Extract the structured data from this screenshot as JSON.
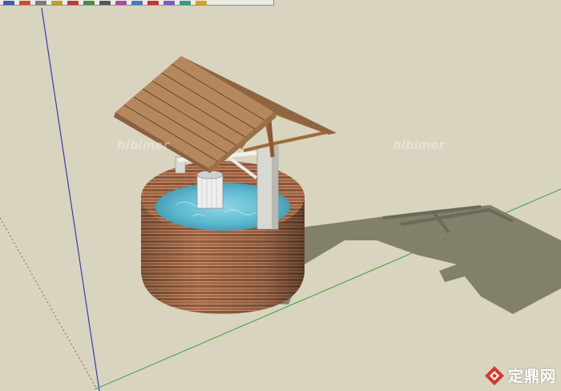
{
  "toolbar": {
    "icons": [
      "select-tool-icon",
      "eraser-tool-icon",
      "paint-tool-icon",
      "pencil-tool-icon",
      "arc-tool-icon",
      "rectangle-tool-icon",
      "push-pull-tool-icon",
      "move-tool-icon",
      "rotate-tool-icon",
      "offset-tool-icon",
      "orbit-tool-icon",
      "pan-tool-icon",
      "zoom-tool-icon"
    ],
    "icon_colors": [
      "#3a5bb8",
      "#d94a2b",
      "#7a7a7a",
      "#c2a01f",
      "#c0392b",
      "#4b8e3c",
      "#555555",
      "#b04aa0",
      "#3a7dc9",
      "#c9302c",
      "#7b5bc4",
      "#2f9c8a",
      "#d6a51a"
    ]
  },
  "scene": {
    "watermarks": [
      "hibimer",
      "hibimer"
    ],
    "colors": {
      "ground": "#d8d4bf",
      "shadow": "#7d7a66",
      "brick": "#a0603d",
      "water": "#5cb8cf",
      "roof": "#b5875c",
      "post": "#d9d9d4",
      "green_axis": "#3aa33a",
      "blue_axis": "#3b3bb0",
      "red_axis": "#c05050"
    }
  },
  "brand": {
    "name": "定鼎网",
    "logo_icon": "diamond-logo-icon"
  }
}
